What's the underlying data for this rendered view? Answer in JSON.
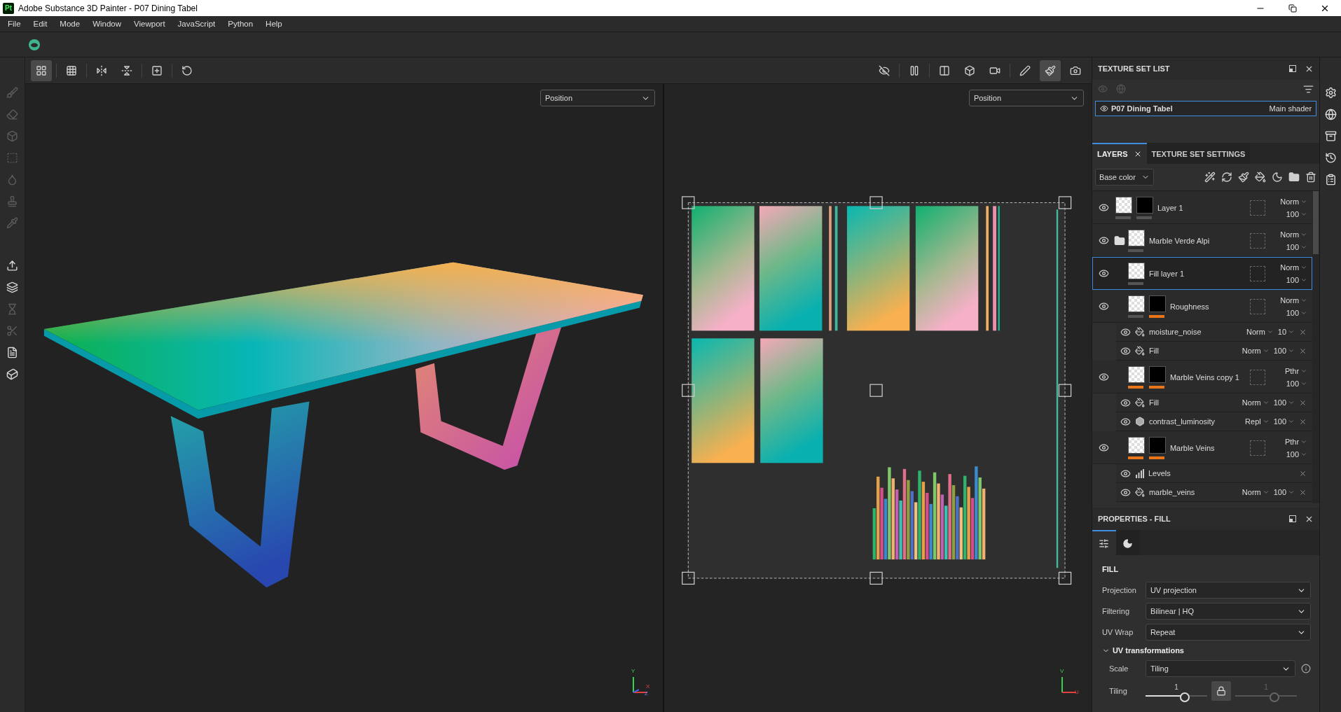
{
  "title_bar": {
    "app_badge": "Pt",
    "title": "Adobe Substance 3D Painter - P07 Dining Tabel"
  },
  "menu": [
    "File",
    "Edit",
    "Mode",
    "Window",
    "Viewport",
    "JavaScript",
    "Python",
    "Help"
  ],
  "tools": [
    {
      "disabled": true
    },
    {
      "disabled": true
    },
    {
      "disabled": true
    },
    {
      "disabled": true
    },
    {
      "disabled": true
    },
    {
      "disabled": true
    },
    {
      "disabled": true
    },
    {
      "disabled": false
    },
    {
      "disabled": false
    },
    {
      "disabled": true
    },
    {
      "disabled": true
    },
    {
      "disabled": false
    },
    {
      "disabled": false
    }
  ],
  "viewport_toolbar": {
    "left": [
      {
        "selected": true
      },
      {
        "selected": false
      },
      {
        "selected": false
      },
      {
        "selected": false
      },
      {
        "selected": false
      },
      {
        "selected": false
      }
    ],
    "right": [
      {
        "selected": false
      },
      {
        "selected": false
      },
      {
        "selected": false
      },
      {
        "selected": false
      },
      {
        "selected": false
      },
      {
        "selected": false
      },
      {
        "selected": true
      },
      {
        "selected": false
      }
    ]
  },
  "viewports": [
    {
      "kind": "model",
      "channel": "Position",
      "axes": [
        "Y",
        "X",
        "Z"
      ]
    },
    {
      "kind": "uv",
      "channel": "Position",
      "axes": [
        "V",
        "U"
      ]
    }
  ],
  "texture_set_list": {
    "title": "TEXTURE SET LIST",
    "items": [
      {
        "name": "P07 Dining Tabel",
        "shader": "Main shader",
        "selected": true
      }
    ]
  },
  "layers_panel": {
    "tabs": [
      {
        "label": "LAYERS",
        "selected": true
      },
      {
        "label": "TEXTURE SET SETTINGS",
        "selected": false
      }
    ],
    "channel": "Base color",
    "layers": [
      {
        "kind": "layer",
        "name": "Layer 1",
        "visible": true,
        "selected": false,
        "blend": "Norm",
        "opacity": "100",
        "thumbs": [
          {
            "kind": "checker",
            "color": "#555555"
          },
          {
            "kind": "mask",
            "color": "#555555"
          }
        ]
      },
      {
        "kind": "folder",
        "name": "Marble Verde Alpi",
        "visible": true,
        "selected": false,
        "blend": "Norm",
        "opacity": "100",
        "thumbs": [
          {
            "kind": "checker",
            "color": "#555555"
          }
        ],
        "children": [
          {
            "kind": "layer",
            "name": "Fill layer 1",
            "visible": true,
            "selected": true,
            "blend": "Norm",
            "opacity": "100",
            "thumbs": [
              {
                "kind": "checker",
                "color": "#555555"
              }
            ]
          },
          {
            "kind": "layer",
            "name": "Roughness",
            "visible": true,
            "selected": false,
            "blend": "Norm",
            "opacity": "100",
            "thumbs": [
              {
                "kind": "checker",
                "color": "#555555"
              },
              {
                "kind": "mask",
                "color": "#e8751a"
              }
            ],
            "children": [
              {
                "kind": "fill",
                "name": "moisture_noise",
                "visible": true,
                "blend": "Norm",
                "opacity": "10"
              },
              {
                "kind": "fill",
                "name": "Fill",
                "visible": true,
                "blend": "Norm",
                "opacity": "100"
              }
            ]
          },
          {
            "kind": "layer",
            "name": "Marble Veins copy 1",
            "visible": true,
            "selected": false,
            "blend": "Pthr",
            "opacity": "100",
            "thumbs": [
              {
                "kind": "checker",
                "color": "#e8751a"
              },
              {
                "kind": "mask",
                "color": "#e8751a"
              }
            ],
            "children": [
              {
                "kind": "fill",
                "name": "Fill",
                "visible": true,
                "blend": "Norm",
                "opacity": "100"
              },
              {
                "kind": "filter",
                "name": "contrast_luminosity",
                "visible": true,
                "blend": "Repl",
                "opacity": "100"
              }
            ]
          },
          {
            "kind": "layer",
            "name": "Marble Veins",
            "visible": true,
            "selected": false,
            "blend": "Pthr",
            "opacity": "100",
            "thumbs": [
              {
                "kind": "checker",
                "color": "#e8751a"
              },
              {
                "kind": "mask",
                "color": "#e8751a"
              }
            ],
            "children": [
              {
                "kind": "levels",
                "name": "Levels",
                "visible": true
              },
              {
                "kind": "fill",
                "name": "marble_veins",
                "visible": true,
                "blend": "Norm",
                "opacity": "100"
              }
            ]
          }
        ]
      }
    ]
  },
  "properties": {
    "title": "PROPERTIES - FILL",
    "tabs": [
      {
        "selected": true
      },
      {
        "selected": false
      }
    ],
    "section": "FILL",
    "fields": [
      {
        "label": "Projection",
        "value": "UV projection"
      },
      {
        "label": "Filtering",
        "value": "Bilinear | HQ"
      },
      {
        "label": "UV Wrap",
        "value": "Repeat"
      }
    ],
    "group": {
      "label": "UV transformations",
      "expanded": true,
      "scale": {
        "label": "Scale",
        "value": "Tiling"
      },
      "tiling": {
        "label": "Tiling",
        "sliders": [
          {
            "value": "1",
            "level": 0.63,
            "disabled": false
          },
          {
            "value": "1",
            "level": 0.63,
            "disabled": true
          }
        ]
      }
    }
  }
}
